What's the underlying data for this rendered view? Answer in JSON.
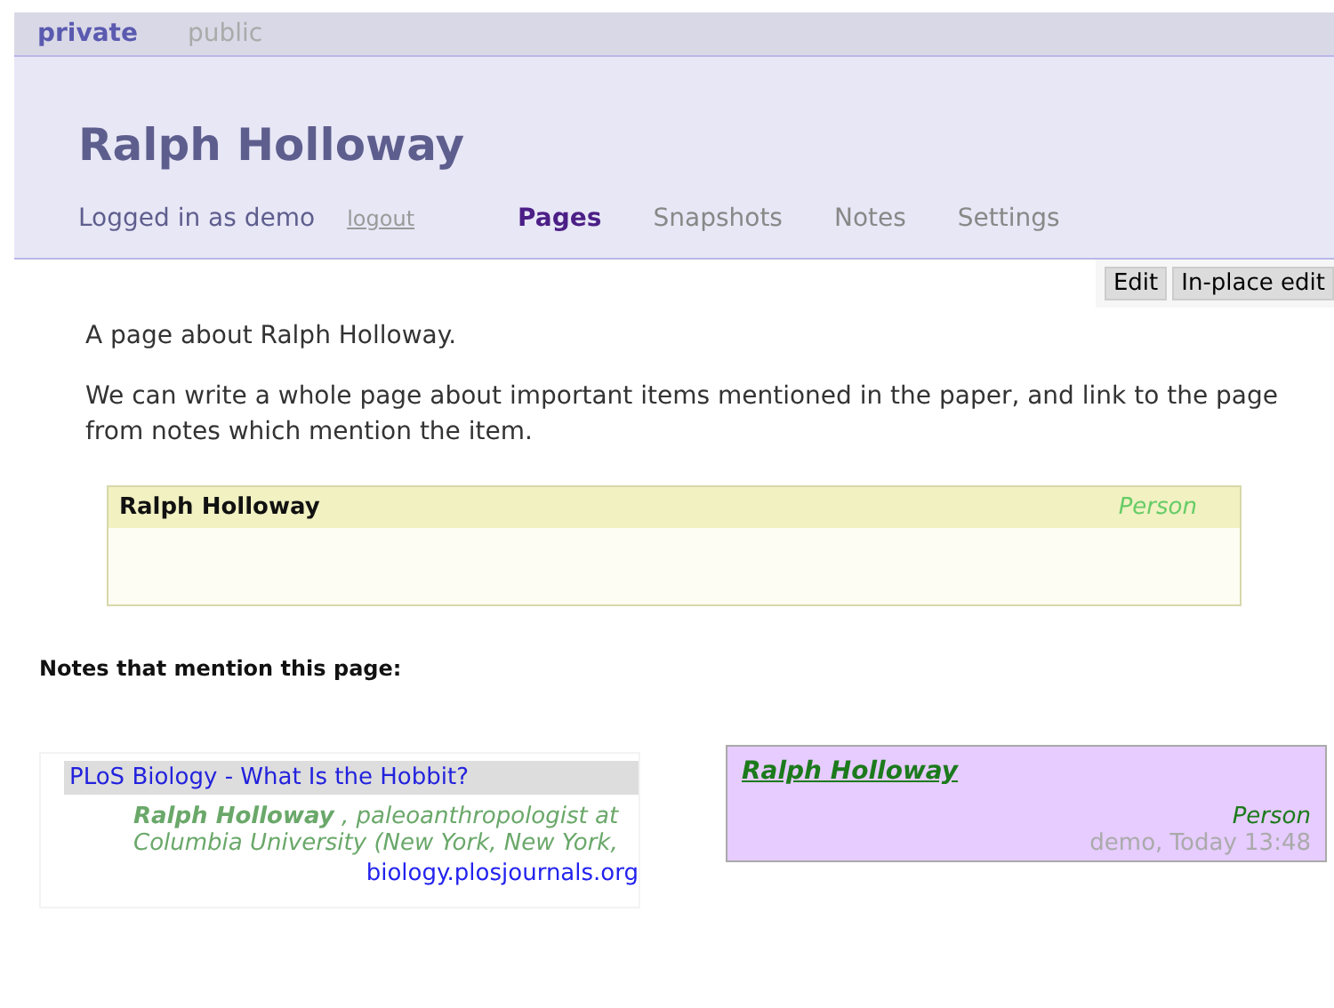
{
  "modes": [
    {
      "label": "private",
      "selected": true
    },
    {
      "label": "public",
      "selected": false
    }
  ],
  "header": {
    "title": "Ralph Holloway",
    "login_text": "Logged in as demo",
    "logout": "logout"
  },
  "nav": [
    {
      "label": "Pages",
      "selected": true
    },
    {
      "label": "Snapshots",
      "selected": false
    },
    {
      "label": "Notes",
      "selected": false
    },
    {
      "label": "Settings",
      "selected": false
    }
  ],
  "actions": [
    "Edit",
    "In-place edit"
  ],
  "paragraphs": [
    "A page about Ralph Holloway.",
    "We can write a whole page about important items mentioned in the paper, and link to the page from notes which mention the item."
  ],
  "item_card": {
    "name": "Ralph Holloway",
    "type": "Person"
  },
  "notes_heading": "Notes that mention this page:",
  "source_note": {
    "title": "PLoS Biology - What Is the Hobbit?",
    "snippet": "**Ralph Holloway** , paleoanthropologist at Columbia University (New York, New York,",
    "domain": "biology.plosjournals.org"
  },
  "annotation": {
    "link": "Ralph Holloway",
    "type": "Person",
    "meta": "demo, Today 13:48"
  }
}
